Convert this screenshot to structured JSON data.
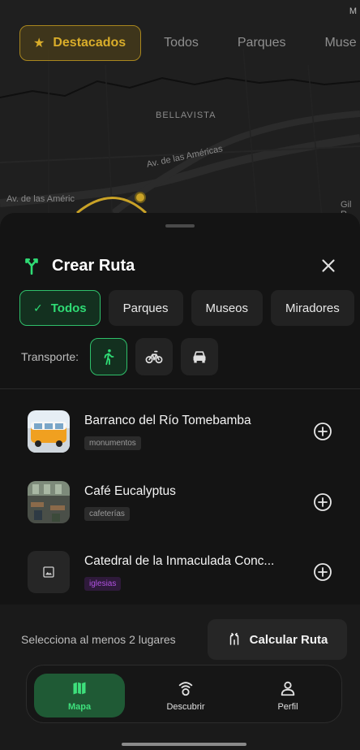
{
  "map": {
    "corner_label": "M",
    "chips": [
      {
        "label": "Destacados",
        "active": true
      },
      {
        "label": "Todos",
        "active": false
      },
      {
        "label": "Parques",
        "active": false
      },
      {
        "label": "Muse",
        "active": false
      }
    ],
    "street_labels": [
      "BELLAVISTA",
      "Av. de las Américas",
      "Av. de las Améric",
      "Gil R"
    ]
  },
  "sheet": {
    "title": "Crear Ruta",
    "filters": [
      {
        "label": "Todos",
        "active": true
      },
      {
        "label": "Parques",
        "active": false
      },
      {
        "label": "Museos",
        "active": false
      },
      {
        "label": "Miradores",
        "active": false
      }
    ],
    "transport_label": "Transporte:",
    "transport_options": [
      {
        "icon": "walk-icon",
        "active": true
      },
      {
        "icon": "bike-icon",
        "active": false
      },
      {
        "icon": "car-icon",
        "active": false
      }
    ],
    "places": [
      {
        "name": "Barranco del Río Tomebamba",
        "tag": "monumentos",
        "tag_color": "#9a9a9a"
      },
      {
        "name": "Café Eucalyptus",
        "tag": "cafeterías",
        "tag_color": "#9a9a9a"
      },
      {
        "name": "Catedral de la Inmaculada Conc...",
        "tag": "iglesias",
        "tag_color": "#b052e0"
      }
    ],
    "footer_text": "Selecciona al menos 2 lugares",
    "calc_button": "Calcular Ruta"
  },
  "nav": {
    "items": [
      {
        "label": "Mapa",
        "icon": "map-icon",
        "active": true
      },
      {
        "label": "Descubrir",
        "icon": "signal-icon",
        "active": false
      },
      {
        "label": "Perfil",
        "icon": "person-icon",
        "active": false
      }
    ]
  },
  "colors": {
    "accent_green": "#2fdc75",
    "accent_gold": "#d9ad2a",
    "tag_purple": "#b052e0"
  }
}
